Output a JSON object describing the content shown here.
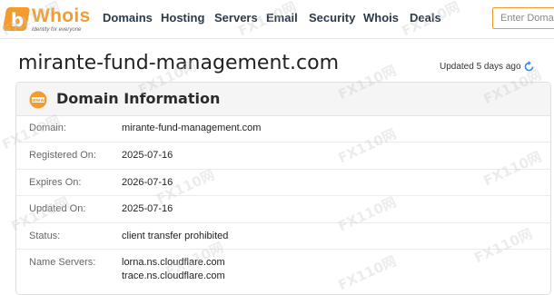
{
  "logo": {
    "mark": "b",
    "word": "Whois",
    "tagline": "Identity for everyone"
  },
  "nav": [
    "Domains",
    "Hosting",
    "Servers",
    "Email",
    "Security",
    "Whois",
    "Deals"
  ],
  "search": {
    "placeholder": "Enter Domain"
  },
  "page": {
    "title": "mirante-fund-management.com",
    "updated": "Updated 5 days ago"
  },
  "card": {
    "title": "Domain Information",
    "rows": [
      {
        "label": "Domain:",
        "value": "mirante-fund-management.com"
      },
      {
        "label": "Registered On:",
        "value": "2025-07-16"
      },
      {
        "label": "Expires On:",
        "value": "2026-07-16"
      },
      {
        "label": "Updated On:",
        "value": "2025-07-16"
      },
      {
        "label": "Status:",
        "value": "client transfer prohibited"
      },
      {
        "label": "Name Servers:",
        "value": [
          "lorna.ns.cloudflare.com",
          "trace.ns.cloudflare.com"
        ]
      }
    ]
  },
  "watermark": "FX110网",
  "colors": {
    "accent": "#f39c2d",
    "refresh": "#3a8ee6"
  },
  "icons": {
    "domain_section": "www-icon",
    "refresh": "refresh-icon"
  }
}
